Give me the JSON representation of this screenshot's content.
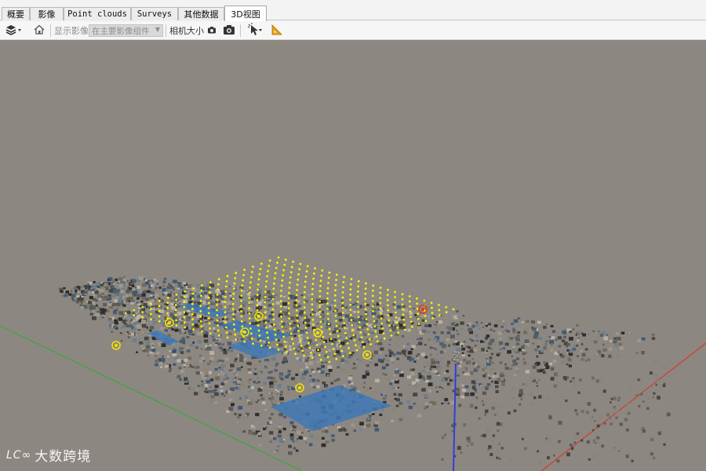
{
  "tabs": [
    {
      "label": "概要",
      "active": false
    },
    {
      "label": "影像",
      "active": false
    },
    {
      "label": "Point clouds",
      "active": false
    },
    {
      "label": "Surveys",
      "active": false
    },
    {
      "label": "其他数据",
      "active": false
    },
    {
      "label": "3D视图",
      "active": true
    }
  ],
  "toolbar": {
    "layers_icon": "layers-icon",
    "home_icon": "home-icon",
    "show_images_label": "显示影像",
    "image_group_select": "在主要影像组件",
    "camera_size_label": "相机大小",
    "small_camera_icon": "small-camera-icon",
    "large_camera_icon": "camera-icon",
    "pointer_icon": "pointer-tool-icon",
    "measure_icon": "ruler-triangle-icon"
  },
  "viewport": {
    "background_color": "#8d8782",
    "axis_label_z": "Z",
    "x_axis_color": "#d23a2e",
    "y_axis_color": "#3aa83a",
    "z_axis_color": "#2f3fd8",
    "camera_marker_color": "#f4f400"
  },
  "watermark": {
    "logo_text": "LC∞",
    "text": "大数跨境"
  }
}
